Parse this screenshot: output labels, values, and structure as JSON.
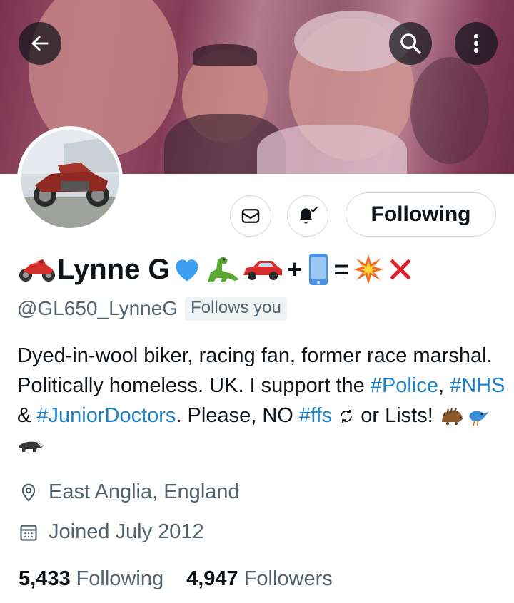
{
  "header": {
    "back_icon": "arrow-left-icon",
    "search_icon": "search-icon",
    "more_icon": "more-vertical-icon"
  },
  "profile": {
    "display_name_text": "Lynne G",
    "name_plus": "+",
    "name_equals": "=",
    "handle": "@GL650_LynneG",
    "follows_you": "Follows you",
    "bio": {
      "part1": "Dyed-in-wool biker, racing fan, former race marshal. Politically homeless. UK. I support the ",
      "tag1": "#Police",
      "sep1": ", ",
      "tag2": "#NHS",
      "sep2": " & ",
      "tag3": "#JuniorDoctors",
      "part2": ". Please, NO ",
      "tag4": "#ffs",
      "part3": " or Lists! "
    },
    "location": "East Anglia, England",
    "joined": "Joined July 2012",
    "following_count": "5,433",
    "following_label": "Following",
    "followers_count": "4,947",
    "followers_label": "Followers"
  },
  "actions": {
    "message_icon": "envelope-icon",
    "notify_icon": "bell-check-icon",
    "following_button": "Following"
  },
  "colors": {
    "link": "#1d83c9",
    "secondary_text": "#536471",
    "primary_text": "#0f1419",
    "border": "#cfd9de"
  }
}
